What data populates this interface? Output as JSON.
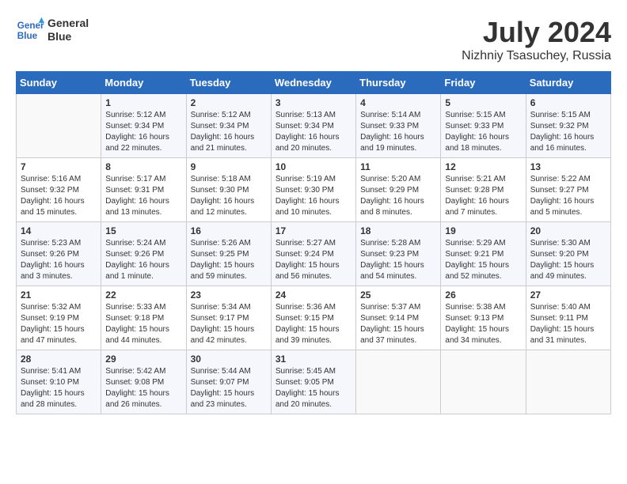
{
  "header": {
    "logo_line1": "General",
    "logo_line2": "Blue",
    "month_year": "July 2024",
    "location": "Nizhniy Tsasuchey, Russia"
  },
  "days_of_week": [
    "Sunday",
    "Monday",
    "Tuesday",
    "Wednesday",
    "Thursday",
    "Friday",
    "Saturday"
  ],
  "weeks": [
    [
      {
        "day": "",
        "info": ""
      },
      {
        "day": "1",
        "info": "Sunrise: 5:12 AM\nSunset: 9:34 PM\nDaylight: 16 hours\nand 22 minutes."
      },
      {
        "day": "2",
        "info": "Sunrise: 5:12 AM\nSunset: 9:34 PM\nDaylight: 16 hours\nand 21 minutes."
      },
      {
        "day": "3",
        "info": "Sunrise: 5:13 AM\nSunset: 9:34 PM\nDaylight: 16 hours\nand 20 minutes."
      },
      {
        "day": "4",
        "info": "Sunrise: 5:14 AM\nSunset: 9:33 PM\nDaylight: 16 hours\nand 19 minutes."
      },
      {
        "day": "5",
        "info": "Sunrise: 5:15 AM\nSunset: 9:33 PM\nDaylight: 16 hours\nand 18 minutes."
      },
      {
        "day": "6",
        "info": "Sunrise: 5:15 AM\nSunset: 9:32 PM\nDaylight: 16 hours\nand 16 minutes."
      }
    ],
    [
      {
        "day": "7",
        "info": "Sunrise: 5:16 AM\nSunset: 9:32 PM\nDaylight: 16 hours\nand 15 minutes."
      },
      {
        "day": "8",
        "info": "Sunrise: 5:17 AM\nSunset: 9:31 PM\nDaylight: 16 hours\nand 13 minutes."
      },
      {
        "day": "9",
        "info": "Sunrise: 5:18 AM\nSunset: 9:30 PM\nDaylight: 16 hours\nand 12 minutes."
      },
      {
        "day": "10",
        "info": "Sunrise: 5:19 AM\nSunset: 9:30 PM\nDaylight: 16 hours\nand 10 minutes."
      },
      {
        "day": "11",
        "info": "Sunrise: 5:20 AM\nSunset: 9:29 PM\nDaylight: 16 hours\nand 8 minutes."
      },
      {
        "day": "12",
        "info": "Sunrise: 5:21 AM\nSunset: 9:28 PM\nDaylight: 16 hours\nand 7 minutes."
      },
      {
        "day": "13",
        "info": "Sunrise: 5:22 AM\nSunset: 9:27 PM\nDaylight: 16 hours\nand 5 minutes."
      }
    ],
    [
      {
        "day": "14",
        "info": "Sunrise: 5:23 AM\nSunset: 9:26 PM\nDaylight: 16 hours\nand 3 minutes."
      },
      {
        "day": "15",
        "info": "Sunrise: 5:24 AM\nSunset: 9:26 PM\nDaylight: 16 hours\nand 1 minute."
      },
      {
        "day": "16",
        "info": "Sunrise: 5:26 AM\nSunset: 9:25 PM\nDaylight: 15 hours\nand 59 minutes."
      },
      {
        "day": "17",
        "info": "Sunrise: 5:27 AM\nSunset: 9:24 PM\nDaylight: 15 hours\nand 56 minutes."
      },
      {
        "day": "18",
        "info": "Sunrise: 5:28 AM\nSunset: 9:23 PM\nDaylight: 15 hours\nand 54 minutes."
      },
      {
        "day": "19",
        "info": "Sunrise: 5:29 AM\nSunset: 9:21 PM\nDaylight: 15 hours\nand 52 minutes."
      },
      {
        "day": "20",
        "info": "Sunrise: 5:30 AM\nSunset: 9:20 PM\nDaylight: 15 hours\nand 49 minutes."
      }
    ],
    [
      {
        "day": "21",
        "info": "Sunrise: 5:32 AM\nSunset: 9:19 PM\nDaylight: 15 hours\nand 47 minutes."
      },
      {
        "day": "22",
        "info": "Sunrise: 5:33 AM\nSunset: 9:18 PM\nDaylight: 15 hours\nand 44 minutes."
      },
      {
        "day": "23",
        "info": "Sunrise: 5:34 AM\nSunset: 9:17 PM\nDaylight: 15 hours\nand 42 minutes."
      },
      {
        "day": "24",
        "info": "Sunrise: 5:36 AM\nSunset: 9:15 PM\nDaylight: 15 hours\nand 39 minutes."
      },
      {
        "day": "25",
        "info": "Sunrise: 5:37 AM\nSunset: 9:14 PM\nDaylight: 15 hours\nand 37 minutes."
      },
      {
        "day": "26",
        "info": "Sunrise: 5:38 AM\nSunset: 9:13 PM\nDaylight: 15 hours\nand 34 minutes."
      },
      {
        "day": "27",
        "info": "Sunrise: 5:40 AM\nSunset: 9:11 PM\nDaylight: 15 hours\nand 31 minutes."
      }
    ],
    [
      {
        "day": "28",
        "info": "Sunrise: 5:41 AM\nSunset: 9:10 PM\nDaylight: 15 hours\nand 28 minutes."
      },
      {
        "day": "29",
        "info": "Sunrise: 5:42 AM\nSunset: 9:08 PM\nDaylight: 15 hours\nand 26 minutes."
      },
      {
        "day": "30",
        "info": "Sunrise: 5:44 AM\nSunset: 9:07 PM\nDaylight: 15 hours\nand 23 minutes."
      },
      {
        "day": "31",
        "info": "Sunrise: 5:45 AM\nSunset: 9:05 PM\nDaylight: 15 hours\nand 20 minutes."
      },
      {
        "day": "",
        "info": ""
      },
      {
        "day": "",
        "info": ""
      },
      {
        "day": "",
        "info": ""
      }
    ]
  ]
}
